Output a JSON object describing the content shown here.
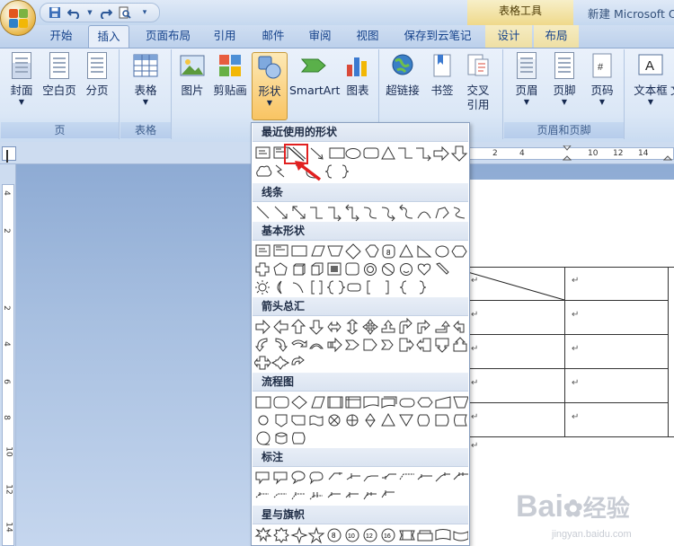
{
  "app": {
    "context_tab_group": "表格工具",
    "document_title": "新建 Microsoft O"
  },
  "quick_access": [
    "save-icon",
    "undo-icon",
    "redo-icon",
    "print-preview-icon",
    "customize-icon"
  ],
  "tabs": [
    "开始",
    "插入",
    "页面布局",
    "引用",
    "邮件",
    "审阅",
    "视图",
    "保存到云笔记",
    "设计",
    "布局"
  ],
  "active_tab": "插入",
  "ribbon": {
    "groups": [
      {
        "label": "页",
        "buttons": [
          "封面",
          "空白页",
          "分页"
        ]
      },
      {
        "label": "表格",
        "buttons": [
          "表格"
        ]
      },
      {
        "label": "",
        "buttons": [
          "图片",
          "剪贴画",
          "形状",
          "SmartArt",
          "图表"
        ]
      },
      {
        "label": "",
        "buttons": [
          "超链接",
          "书签",
          "交叉\n引用"
        ]
      },
      {
        "label": "页眉和页脚",
        "buttons": [
          "页眉",
          "页脚",
          "页码"
        ]
      },
      {
        "label": "",
        "buttons": [
          "文本框",
          "文"
        ]
      }
    ],
    "pressed_button": "形状"
  },
  "ruler": {
    "horizontal_numbers": [
      "2",
      "4",
      "8",
      "10",
      "12",
      "14",
      "16"
    ],
    "vertical_numbers": [
      "4",
      "2",
      "2",
      "4",
      "6",
      "8",
      "10",
      "12",
      "14"
    ]
  },
  "shapes_menu": {
    "sections": [
      "最近使用的形状",
      "线条",
      "基本形状",
      "箭头总汇",
      "流程图",
      "标注",
      "星与旗帜"
    ],
    "highlighted_shape": "line-shape"
  },
  "watermark": {
    "brand": "Bai",
    "brand2": "经验",
    "url": "jingyan.baidu.com"
  },
  "colors": {
    "accent": "#15428b",
    "highlight": "#e12020",
    "pressed": "#f9c463"
  }
}
